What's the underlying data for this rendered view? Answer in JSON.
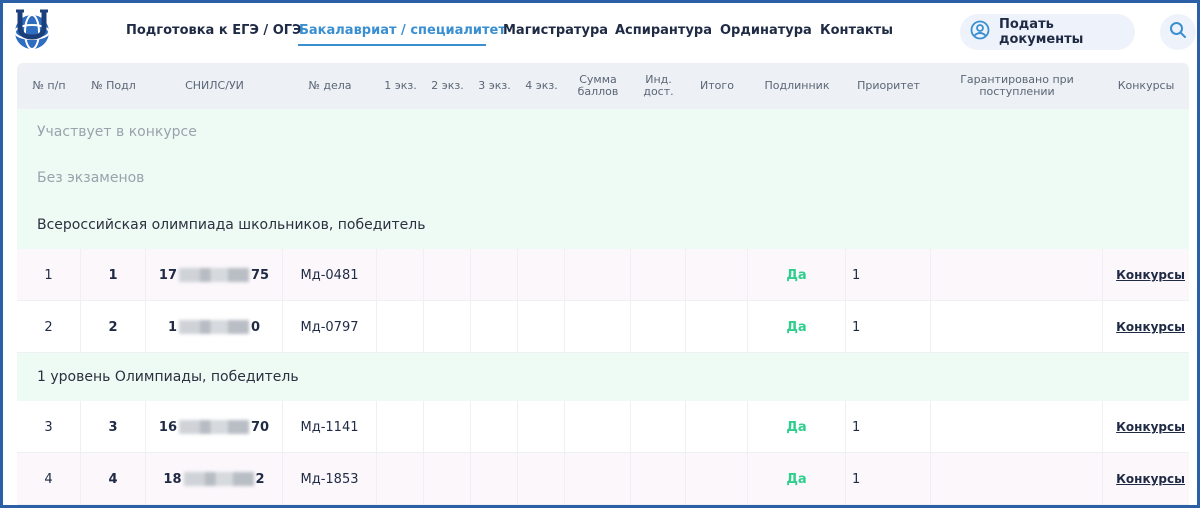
{
  "nav": {
    "items": [
      {
        "label": "Подготовка к ЕГЭ / ОГЭ",
        "active": false
      },
      {
        "label": "Бакалавриат / специалитет",
        "active": true
      },
      {
        "label": "Магистратура",
        "active": false
      },
      {
        "label": "Аспирантура",
        "active": false
      },
      {
        "label": "Ординатура",
        "active": false
      },
      {
        "label": "Контакты",
        "active": false
      }
    ],
    "submit_label": "Подать документы"
  },
  "table": {
    "headers": [
      "№ п/п",
      "№ Подл",
      "СНИЛС/УИ",
      "№ дела",
      "1 экз.",
      "2 экз.",
      "3 экз.",
      "4 экз.",
      "Сумма баллов",
      "Инд. дост.",
      "Итого",
      "Подлинник",
      "Приоритет",
      "Гарантировано при поступлении",
      "Конкурсы"
    ],
    "sections": {
      "s1": "Участвует в конкурсе",
      "s2": "Без экзаменов",
      "s3": "Всероссийская олимпиада школьников, победитель",
      "s4": "1 уровень Олимпиады, победитель"
    },
    "rows": [
      {
        "n": "1",
        "podl": "1",
        "snils_start": "17",
        "snils_end": "75",
        "delo": "Мд-0481",
        "original": "Да",
        "priority": "1",
        "link": "Конкурсы"
      },
      {
        "n": "2",
        "podl": "2",
        "snils_start": "1",
        "snils_end": "0",
        "delo": "Мд-0797",
        "original": "Да",
        "priority": "1",
        "link": "Конкурсы"
      },
      {
        "n": "3",
        "podl": "3",
        "snils_start": "16",
        "snils_end": "70",
        "delo": "Мд-1141",
        "original": "Да",
        "priority": "1",
        "link": "Конкурсы"
      },
      {
        "n": "4",
        "podl": "4",
        "snils_start": "18",
        "snils_end": "2",
        "delo": "Мд-1853",
        "original": "Да",
        "priority": "1",
        "link": "Конкурсы"
      }
    ]
  },
  "colors": {
    "accent": "#3a8fd1",
    "frame": "#2b5fa6",
    "section_bg": "#eefaf4",
    "yes": "#2ecf8c"
  },
  "icons": {
    "logo": "university-logo-icon",
    "submit": "user-circle-icon",
    "search": "search-icon"
  }
}
